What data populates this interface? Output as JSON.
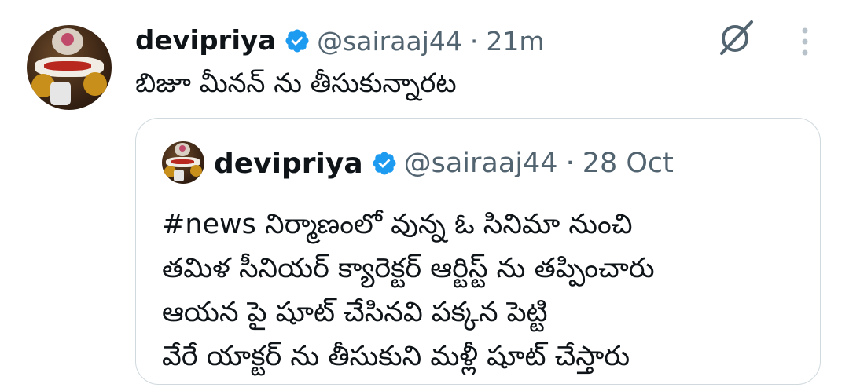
{
  "tweet": {
    "author_name": "devipriya",
    "handle": "@sairaaj44",
    "separator": "·",
    "time": "21m",
    "text": "బిజూ మీనన్ ను తీసుకున్నారట"
  },
  "quoted_tweet": {
    "author_name": "devipriya",
    "handle": "@sairaaj44",
    "separator": "·",
    "time": "28 Oct",
    "lines": [
      "#news నిర్మాణంలో వున్న ఓ సినిమా నుంచి",
      "తమిళ సీనియర్ క్యారెక్టర్ ఆర్టిస్ట్ ను తప్పించారు",
      "ఆయన పై షూట్ చేసినవి పక్కన పెట్టి",
      "వేరే యాక్టర్ ను తీసుకుని మళ్లీ షూట్ చేస్తారు"
    ]
  },
  "icons": {
    "verified": "verified-badge-icon",
    "grok": "grok-icon",
    "more": "more-vertical-icon"
  },
  "colors": {
    "verified_blue": "#1d9bf0",
    "secondary_text": "#536471",
    "border": "#cfd9de"
  }
}
